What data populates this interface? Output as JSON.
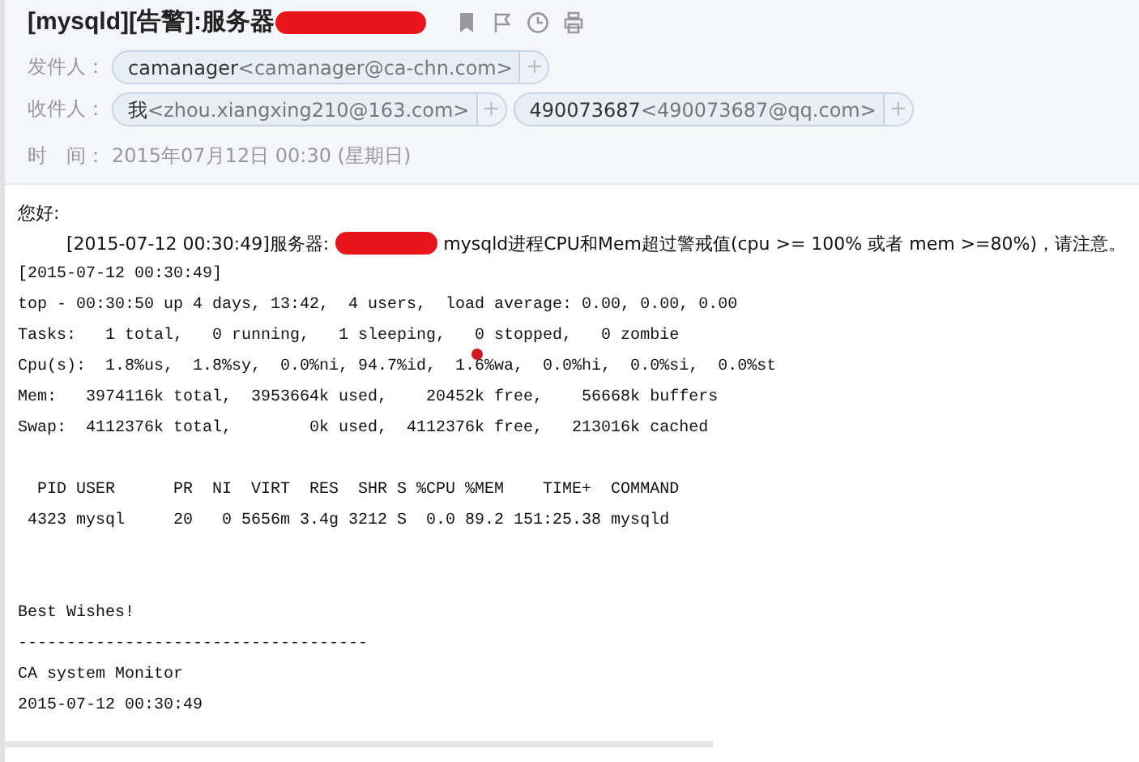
{
  "subject": "[mysqld][告警]:服务器",
  "header_fields": [
    {
      "label": "发件人：",
      "contacts": [
        {
          "name": "camanager",
          "address": "<camanager@ca-chn.com>",
          "add": "+"
        }
      ]
    },
    {
      "label": "收件人：",
      "contacts": [
        {
          "name": "我",
          "address": "<zhou.xiangxing210@163.com>",
          "add": "+"
        },
        {
          "name": "490073687",
          "address": "<490073687@qq.com>",
          "add": "+"
        }
      ]
    }
  ],
  "time": {
    "label": "时　间：",
    "value": "2015年07月12日 00:30 (星期日)"
  },
  "body": {
    "greeting": "您好:",
    "alert": {
      "prefix": "[2015-07-12 00:30:49]服务器:",
      "suffix": "mysqld进程CPU和Mem超过警戒值(cpu >= 100% 或者 mem >=80%)，请注意。"
    },
    "stats": [
      "[2015-07-12 00:30:49]",
      "top - 00:30:50 up 4 days, 13:42,  4 users,  load average: 0.00, 0.00, 0.00",
      "Tasks:   1 total,   0 running,   1 sleeping,   0 stopped,   0 zombie",
      "Cpu(s):  1.8%us,  1.8%sy,  0.0%ni, 94.7%id,  1.6%wa,  0.0%hi,  0.0%si,  0.0%st",
      "Mem:   3974116k total,  3953664k used,    20452k free,    56668k buffers",
      "Swap:  4112376k total,        0k used,  4112376k free,   213016k cached"
    ],
    "process_table": [
      "  PID USER      PR  NI  VIRT  RES  SHR S %CPU %MEM    TIME+  COMMAND",
      " 4323 mysql     20   0 5656m 3.4g 3212 S  0.0 89.2 151:25.38 mysqld"
    ],
    "signature": [
      "Best Wishes!",
      "------------------------------------",
      "CA system Monitor",
      "2015-07-12 00:30:49"
    ]
  }
}
